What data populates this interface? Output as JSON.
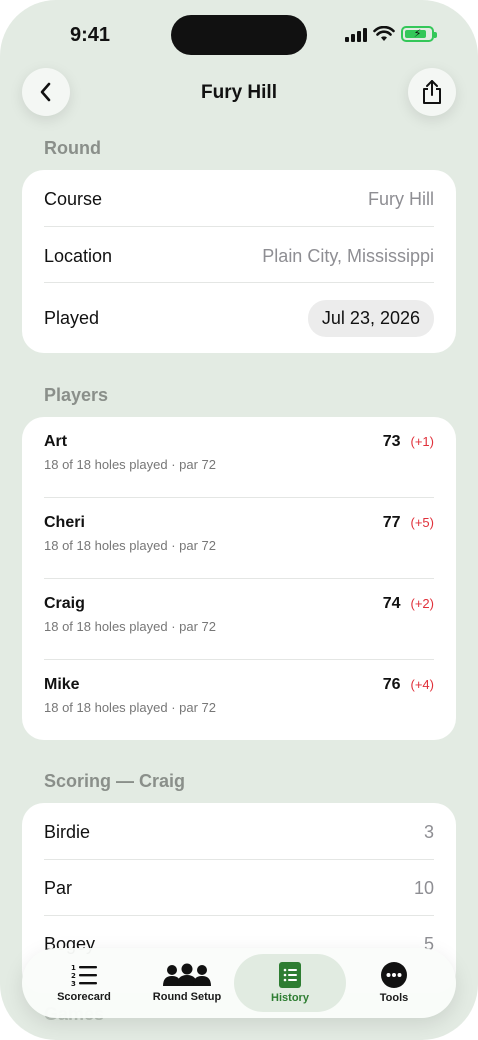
{
  "status": {
    "time": "9:41"
  },
  "nav": {
    "title": "Fury Hill",
    "back_icon": "chevron-left-icon",
    "share_icon": "share-icon"
  },
  "round": {
    "header": "Round",
    "rows": [
      {
        "label": "Course",
        "value": "Fury Hill"
      },
      {
        "label": "Location",
        "value": "Plain City, Mississippi"
      },
      {
        "label": "Played",
        "value": "Jul 23, 2026"
      }
    ]
  },
  "players": {
    "header": "Players",
    "items": [
      {
        "name": "Art",
        "sub": "18 of 18 holes played · par 72",
        "score": "73",
        "diff": "(+1)"
      },
      {
        "name": "Cheri",
        "sub": "18 of 18 holes played · par 72",
        "score": "77",
        "diff": "(+5)"
      },
      {
        "name": "Craig",
        "sub": "18 of 18 holes played · par 72",
        "score": "74",
        "diff": "(+2)"
      },
      {
        "name": "Mike",
        "sub": "18 of 18 holes played · par 72",
        "score": "76",
        "diff": "(+4)"
      }
    ]
  },
  "scoring": {
    "header": "Scoring — Craig",
    "rows": [
      {
        "label": "Birdie",
        "value": "3"
      },
      {
        "label": "Par",
        "value": "10"
      },
      {
        "label": "Bogey",
        "value": "5"
      }
    ]
  },
  "next_section_header": "Games",
  "tabbar": {
    "tabs": [
      {
        "label": "Scorecard",
        "icon": "numbered-list-icon",
        "active": false
      },
      {
        "label": "Round Setup",
        "icon": "group-icon",
        "active": false
      },
      {
        "label": "History",
        "icon": "book-icon",
        "active": true
      },
      {
        "label": "Tools",
        "icon": "more-icon",
        "active": false
      }
    ]
  },
  "colors": {
    "background": "#e3ebe3",
    "accent": "#2e7d32",
    "negative": "#e0303a",
    "battery": "#34c759"
  }
}
